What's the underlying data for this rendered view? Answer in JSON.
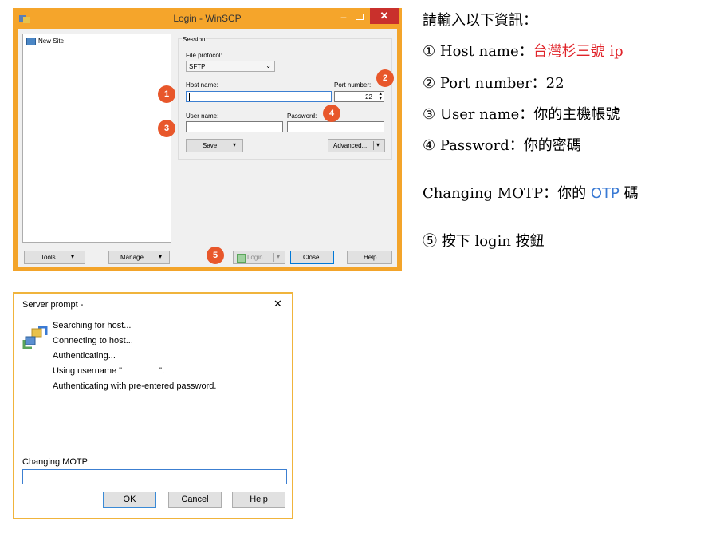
{
  "login_window": {
    "title": "Login - WinSCP",
    "minimize_glyph": "–",
    "close_glyph": "✕",
    "site_tree": {
      "item": "New Site"
    },
    "session": {
      "group_label": "Session",
      "file_protocol_label": "File protocol:",
      "file_protocol_value": "SFTP",
      "host_name_label": "Host name:",
      "host_name_value": "",
      "port_number_label": "Port number:",
      "port_number_value": "22",
      "user_name_label": "User name:",
      "user_name_value": "",
      "password_label": "Password:",
      "password_value": "",
      "save_label": "Save",
      "advanced_label": "Advanced..."
    },
    "bottom": {
      "tools_label": "Tools",
      "manage_label": "Manage",
      "login_label": "Login",
      "close_label": "Close",
      "help_label": "Help"
    },
    "badges": [
      "1",
      "2",
      "3",
      "4",
      "5"
    ],
    "accent_color": "#e8572b",
    "frame_color": "#f3a42a"
  },
  "prompt_dialog": {
    "title": "Server prompt -",
    "close_glyph": "✕",
    "messages": [
      "Searching for host...",
      "Connecting to host...",
      "Authenticating...",
      "Using username \"",
      "Authenticating with pre-entered password."
    ],
    "username_suffix": "\".",
    "motp_label": "Changing MOTP:",
    "motp_value": "",
    "ok_label": "OK",
    "cancel_label": "Cancel",
    "help_label": "Help"
  },
  "instructions": {
    "heading": "請輸入以下資訊：",
    "step1_num": "①",
    "step1_text": "Host name：",
    "step1_value": "台灣杉三號 ip",
    "step2_num": "②",
    "step2_text": "Port number：22",
    "step3_num": "③",
    "step3_text": "User name：你的主機帳號",
    "step4_num": "④",
    "step4_text": "Password：你的密碼",
    "motp_prefix": "Changing MOTP：你的 ",
    "motp_otp": "OTP",
    "motp_suffix": " 碼",
    "step5_num": "⑤",
    "step5_text": "按下 login 按鈕",
    "red_color": "#e0242a",
    "blue_color": "#3a7ad4"
  }
}
